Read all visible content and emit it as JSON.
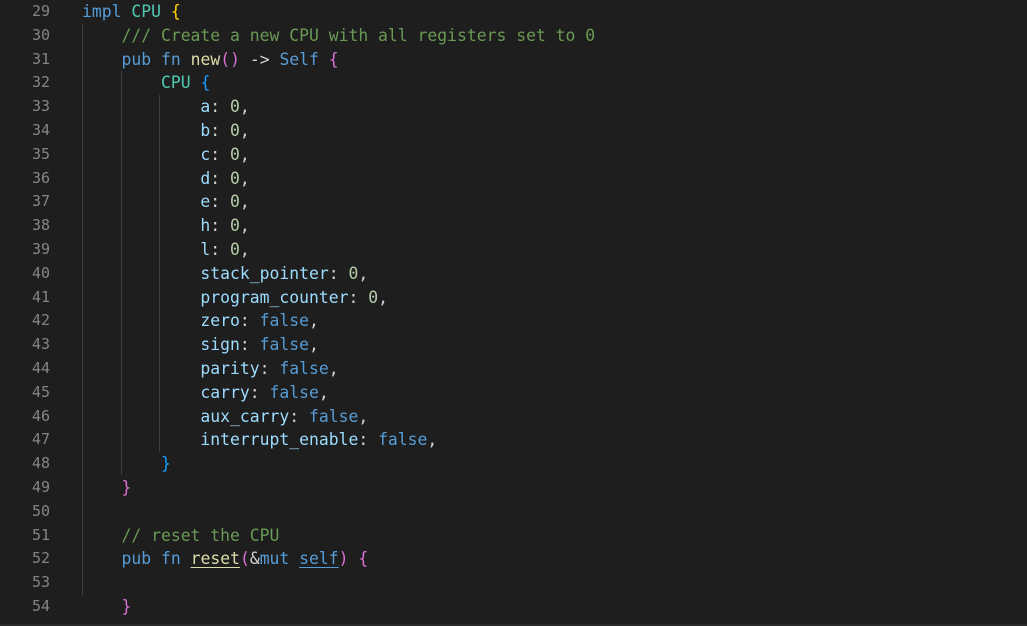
{
  "editor": {
    "language": "rust",
    "theme_colors": {
      "background": "#1e1e1e",
      "line_number": "#858585",
      "keyword": "#569cd6",
      "type": "#4ec9b0",
      "function": "#dcdcaa",
      "field": "#9cdcfe",
      "number": "#b5cea8",
      "comment": "#6a9955",
      "bracket_level_1": "#ffd700",
      "bracket_level_2": "#da70d6",
      "bracket_level_3": "#179fff"
    },
    "lines": [
      {
        "number": "29",
        "indent": "",
        "tokens": [
          {
            "t": "impl",
            "c": "kw"
          },
          {
            "t": " ",
            "c": "p"
          },
          {
            "t": "CPU",
            "c": "ty"
          },
          {
            "t": " ",
            "c": "p"
          },
          {
            "t": "{",
            "c": "b1"
          }
        ]
      },
      {
        "number": "30",
        "indent": "    ",
        "tokens": [
          {
            "t": "/// Create a new CPU with all registers set to 0",
            "c": "cm"
          }
        ]
      },
      {
        "number": "31",
        "indent": "    ",
        "tokens": [
          {
            "t": "pub",
            "c": "kw"
          },
          {
            "t": " ",
            "c": "p"
          },
          {
            "t": "fn",
            "c": "kw"
          },
          {
            "t": " ",
            "c": "p"
          },
          {
            "t": "new",
            "c": "fn"
          },
          {
            "t": "()",
            "c": "b2"
          },
          {
            "t": " -> ",
            "c": "p"
          },
          {
            "t": "Self",
            "c": "kw"
          },
          {
            "t": " ",
            "c": "p"
          },
          {
            "t": "{",
            "c": "b2"
          }
        ]
      },
      {
        "number": "32",
        "indent": "        ",
        "tokens": [
          {
            "t": "CPU",
            "c": "ty"
          },
          {
            "t": " ",
            "c": "p"
          },
          {
            "t": "{",
            "c": "b3"
          }
        ]
      },
      {
        "number": "33",
        "indent": "            ",
        "tokens": [
          {
            "t": "a",
            "c": "pm"
          },
          {
            "t": ": ",
            "c": "p"
          },
          {
            "t": "0",
            "c": "nu"
          },
          {
            "t": ",",
            "c": "p"
          }
        ]
      },
      {
        "number": "34",
        "indent": "            ",
        "tokens": [
          {
            "t": "b",
            "c": "pm"
          },
          {
            "t": ": ",
            "c": "p"
          },
          {
            "t": "0",
            "c": "nu"
          },
          {
            "t": ",",
            "c": "p"
          }
        ]
      },
      {
        "number": "35",
        "indent": "            ",
        "tokens": [
          {
            "t": "c",
            "c": "pm"
          },
          {
            "t": ": ",
            "c": "p"
          },
          {
            "t": "0",
            "c": "nu"
          },
          {
            "t": ",",
            "c": "p"
          }
        ]
      },
      {
        "number": "36",
        "indent": "            ",
        "tokens": [
          {
            "t": "d",
            "c": "pm"
          },
          {
            "t": ": ",
            "c": "p"
          },
          {
            "t": "0",
            "c": "nu"
          },
          {
            "t": ",",
            "c": "p"
          }
        ]
      },
      {
        "number": "37",
        "indent": "            ",
        "tokens": [
          {
            "t": "e",
            "c": "pm"
          },
          {
            "t": ": ",
            "c": "p"
          },
          {
            "t": "0",
            "c": "nu"
          },
          {
            "t": ",",
            "c": "p"
          }
        ]
      },
      {
        "number": "38",
        "indent": "            ",
        "tokens": [
          {
            "t": "h",
            "c": "pm"
          },
          {
            "t": ": ",
            "c": "p"
          },
          {
            "t": "0",
            "c": "nu"
          },
          {
            "t": ",",
            "c": "p"
          }
        ]
      },
      {
        "number": "39",
        "indent": "            ",
        "tokens": [
          {
            "t": "l",
            "c": "pm"
          },
          {
            "t": ": ",
            "c": "p"
          },
          {
            "t": "0",
            "c": "nu"
          },
          {
            "t": ",",
            "c": "p"
          }
        ]
      },
      {
        "number": "40",
        "indent": "            ",
        "tokens": [
          {
            "t": "stack_pointer",
            "c": "pm"
          },
          {
            "t": ": ",
            "c": "p"
          },
          {
            "t": "0",
            "c": "nu"
          },
          {
            "t": ",",
            "c": "p"
          }
        ]
      },
      {
        "number": "41",
        "indent": "            ",
        "tokens": [
          {
            "t": "program_counter",
            "c": "pm"
          },
          {
            "t": ": ",
            "c": "p"
          },
          {
            "t": "0",
            "c": "nu"
          },
          {
            "t": ",",
            "c": "p"
          }
        ]
      },
      {
        "number": "42",
        "indent": "            ",
        "tokens": [
          {
            "t": "zero",
            "c": "pm"
          },
          {
            "t": ": ",
            "c": "p"
          },
          {
            "t": "false",
            "c": "kw"
          },
          {
            "t": ",",
            "c": "p"
          }
        ]
      },
      {
        "number": "43",
        "indent": "            ",
        "tokens": [
          {
            "t": "sign",
            "c": "pm"
          },
          {
            "t": ": ",
            "c": "p"
          },
          {
            "t": "false",
            "c": "kw"
          },
          {
            "t": ",",
            "c": "p"
          }
        ]
      },
      {
        "number": "44",
        "indent": "            ",
        "tokens": [
          {
            "t": "parity",
            "c": "pm"
          },
          {
            "t": ": ",
            "c": "p"
          },
          {
            "t": "false",
            "c": "kw"
          },
          {
            "t": ",",
            "c": "p"
          }
        ]
      },
      {
        "number": "45",
        "indent": "            ",
        "tokens": [
          {
            "t": "carry",
            "c": "pm"
          },
          {
            "t": ": ",
            "c": "p"
          },
          {
            "t": "false",
            "c": "kw"
          },
          {
            "t": ",",
            "c": "p"
          }
        ]
      },
      {
        "number": "46",
        "indent": "            ",
        "tokens": [
          {
            "t": "aux_carry",
            "c": "pm"
          },
          {
            "t": ": ",
            "c": "p"
          },
          {
            "t": "false",
            "c": "kw"
          },
          {
            "t": ",",
            "c": "p"
          }
        ]
      },
      {
        "number": "47",
        "indent": "            ",
        "tokens": [
          {
            "t": "interrupt_enable",
            "c": "pm"
          },
          {
            "t": ": ",
            "c": "p"
          },
          {
            "t": "false",
            "c": "kw"
          },
          {
            "t": ",",
            "c": "p"
          }
        ]
      },
      {
        "number": "48",
        "indent": "        ",
        "tokens": [
          {
            "t": "}",
            "c": "b3"
          }
        ]
      },
      {
        "number": "49",
        "indent": "    ",
        "tokens": [
          {
            "t": "}",
            "c": "b2"
          }
        ]
      },
      {
        "number": "50",
        "indent": "",
        "tokens": []
      },
      {
        "number": "51",
        "indent": "    ",
        "tokens": [
          {
            "t": "// reset the CPU",
            "c": "cm"
          }
        ]
      },
      {
        "number": "52",
        "indent": "    ",
        "tokens": [
          {
            "t": "pub",
            "c": "kw"
          },
          {
            "t": " ",
            "c": "p"
          },
          {
            "t": "fn",
            "c": "kw"
          },
          {
            "t": " ",
            "c": "p"
          },
          {
            "t": "reset",
            "c": "fn ul"
          },
          {
            "t": "(",
            "c": "b2"
          },
          {
            "t": "&",
            "c": "p"
          },
          {
            "t": "mut",
            "c": "kw"
          },
          {
            "t": " ",
            "c": "p"
          },
          {
            "t": "self",
            "c": "kw ul"
          },
          {
            "t": ")",
            "c": "b2"
          },
          {
            "t": " ",
            "c": "p"
          },
          {
            "t": "{",
            "c": "b2"
          }
        ]
      },
      {
        "number": "53",
        "indent": "",
        "tokens": []
      },
      {
        "number": "54",
        "indent": "    ",
        "tokens": [
          {
            "t": "}",
            "c": "b2"
          }
        ]
      }
    ]
  }
}
